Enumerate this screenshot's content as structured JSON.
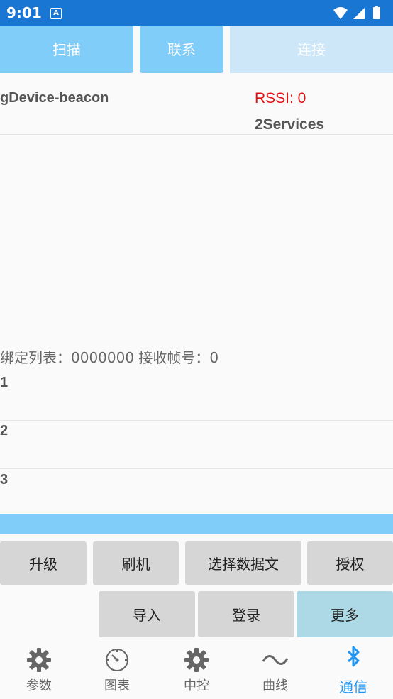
{
  "status_bar": {
    "time": "9:01",
    "notification_letter": "A"
  },
  "top_buttons": {
    "scan": "扫描",
    "contact": "联系",
    "connect": "连接"
  },
  "device": {
    "name": "gDevice-beacon",
    "rssi": "RSSI: 0",
    "services": "2Services"
  },
  "bind_info": "绑定列表：0000000   接收帧号：0",
  "list_items": [
    "1",
    "2",
    "3"
  ],
  "progress": {
    "percent": 100
  },
  "actions": {
    "upgrade": "升级",
    "flash": "刷机",
    "select_file": "选择数据文",
    "authorize": "授权",
    "import": "导入",
    "login": "登录",
    "more": "更多"
  },
  "bottom_nav": [
    {
      "label": "参数",
      "icon": "gear-icon"
    },
    {
      "label": "图表",
      "icon": "gauge-icon"
    },
    {
      "label": "中控",
      "icon": "gear-icon"
    },
    {
      "label": "曲线",
      "icon": "wave-icon"
    },
    {
      "label": "通信",
      "icon": "bluetooth-icon",
      "active": true
    }
  ],
  "colors": {
    "status_bar": "#1976d2",
    "accent": "#81cdf9",
    "active_tab": "#2196f3",
    "rssi": "#e41010"
  }
}
